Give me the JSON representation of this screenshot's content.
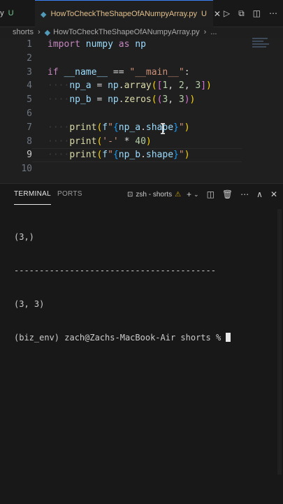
{
  "tabs": {
    "previous": {
      "label": "py",
      "status": "U"
    },
    "active": {
      "icon": "python-file-icon",
      "label": "HowToCheckTheShapeOfANumpyArray.py",
      "status": "U",
      "close": "✕"
    }
  },
  "breadcrumb": {
    "folder": "shorts",
    "file": "HowToCheckTheShapeOfANumpyArray.py",
    "more": "..."
  },
  "editor": {
    "line_numbers": [
      "1",
      "2",
      "3",
      "4",
      "5",
      "6",
      "7",
      "8",
      "9",
      "10"
    ],
    "active_line": 9,
    "lines": [
      [
        [
          "kw",
          "import"
        ],
        [
          "op",
          " "
        ],
        [
          "id",
          "numpy"
        ],
        [
          "op",
          " "
        ],
        [
          "kw",
          "as"
        ],
        [
          "op",
          " "
        ],
        [
          "id",
          "np"
        ]
      ],
      [],
      [
        [
          "kw",
          "if"
        ],
        [
          "op",
          " "
        ],
        [
          "id",
          "__name__"
        ],
        [
          "op",
          " == "
        ],
        [
          "str",
          "\"__main__\""
        ],
        [
          "op",
          ":"
        ]
      ],
      [
        [
          "ind",
          "····"
        ],
        [
          "id",
          "np_a"
        ],
        [
          "op",
          " = "
        ],
        [
          "id",
          "np"
        ],
        [
          "op",
          "."
        ],
        [
          "fn",
          "array"
        ],
        [
          "br1",
          "("
        ],
        [
          "br2",
          "["
        ],
        [
          "num",
          "1"
        ],
        [
          "op",
          ", "
        ],
        [
          "num",
          "2"
        ],
        [
          "op",
          ", "
        ],
        [
          "num",
          "3"
        ],
        [
          "br2",
          "]"
        ],
        [
          "br1",
          ")"
        ]
      ],
      [
        [
          "ind",
          "····"
        ],
        [
          "id",
          "np_b"
        ],
        [
          "op",
          " = "
        ],
        [
          "id",
          "np"
        ],
        [
          "op",
          "."
        ],
        [
          "fn",
          "zeros"
        ],
        [
          "br1",
          "("
        ],
        [
          "br2",
          "("
        ],
        [
          "num",
          "3"
        ],
        [
          "op",
          ", "
        ],
        [
          "num",
          "3"
        ],
        [
          "br2",
          ")"
        ],
        [
          "br1",
          ")"
        ]
      ],
      [],
      [
        [
          "ind",
          "····"
        ],
        [
          "fn",
          "print"
        ],
        [
          "br1",
          "("
        ],
        [
          "id",
          "f"
        ],
        [
          "str",
          "\""
        ],
        [
          "br3",
          "{"
        ],
        [
          "id",
          "np_a"
        ],
        [
          "op",
          "."
        ],
        [
          "id",
          "shape"
        ],
        [
          "br3",
          "}"
        ],
        [
          "str",
          "\""
        ],
        [
          "br1",
          ")"
        ]
      ],
      [
        [
          "ind",
          "····"
        ],
        [
          "fn",
          "print"
        ],
        [
          "br1",
          "("
        ],
        [
          "str",
          "'-'"
        ],
        [
          "op",
          " * "
        ],
        [
          "num",
          "40"
        ],
        [
          "br1",
          ")"
        ]
      ],
      [
        [
          "ind",
          "····"
        ],
        [
          "fn",
          "print"
        ],
        [
          "br1",
          "("
        ],
        [
          "id",
          "f"
        ],
        [
          "str",
          "\""
        ],
        [
          "br3",
          "{"
        ],
        [
          "id",
          "np_b"
        ],
        [
          "op",
          "."
        ],
        [
          "id",
          "shape"
        ],
        [
          "br3",
          "}"
        ],
        [
          "str",
          "\""
        ],
        [
          "br1",
          ")"
        ]
      ],
      []
    ]
  },
  "panel": {
    "tabs": [
      "TERMINAL",
      "PORTS"
    ],
    "active_tab": "TERMINAL",
    "terminal_name": "zsh - shorts",
    "terminal_lines": [
      "(3,)",
      "----------------------------------------",
      "(3, 3)",
      "(biz_env) zach@Zachs-MacBook-Air shorts % "
    ]
  },
  "colors": {
    "accent": "#3b82f6",
    "modified": "#e2c08d",
    "untracked": "#73c991",
    "warning": "#cca700"
  }
}
